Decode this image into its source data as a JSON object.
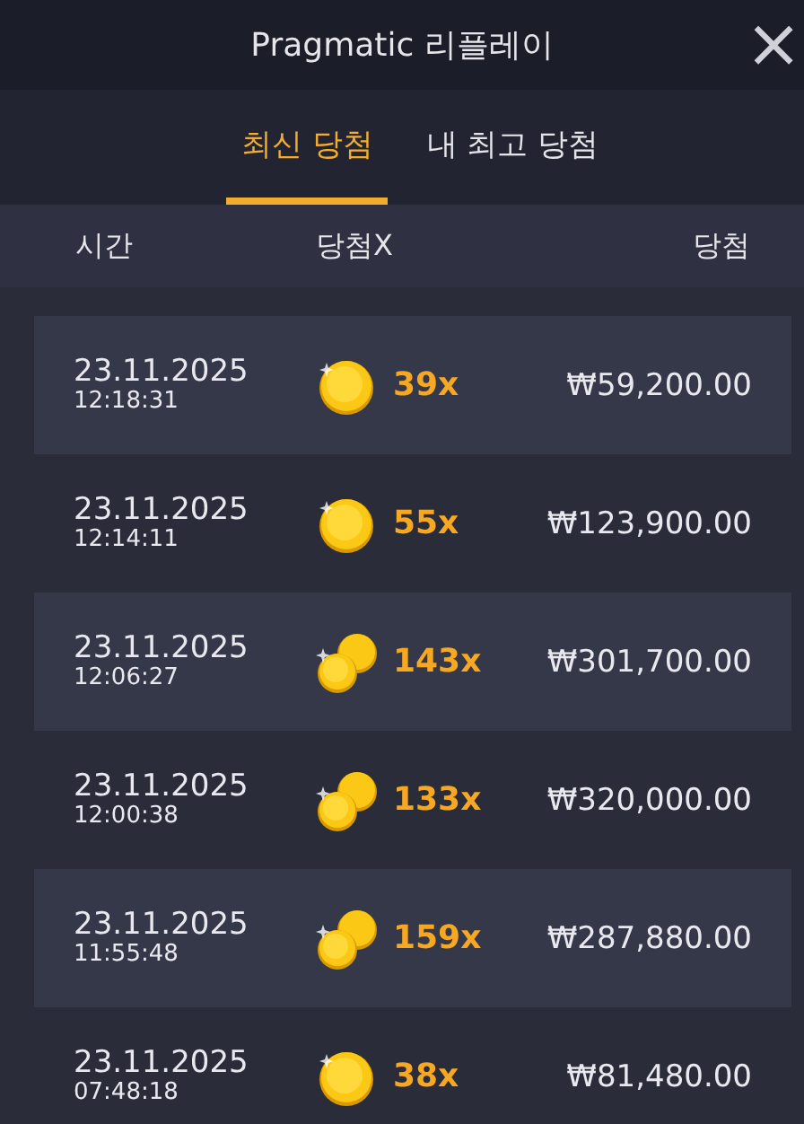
{
  "window": {
    "title": "Pragmatic 리플레이",
    "close": "×"
  },
  "tabs": [
    {
      "label": "최신 당첨",
      "selected": true
    },
    {
      "label": "내 최고 당첨",
      "selected": false
    }
  ],
  "columns": [
    "시간",
    "당첨X",
    "당첨"
  ],
  "rows": [
    {
      "date": "23.11.2025",
      "time": "12:18:31",
      "kind": "single",
      "multiplier": "39x",
      "win": "₩59,200.00"
    },
    {
      "date": "23.11.2025",
      "time": "12:14:11",
      "kind": "single",
      "multiplier": "55x",
      "win": "₩123,900.00"
    },
    {
      "date": "23.11.2025",
      "time": "12:06:27",
      "kind": "stack",
      "multiplier": "143x",
      "win": "₩301,700.00"
    },
    {
      "date": "23.11.2025",
      "time": "12:00:38",
      "kind": "stack",
      "multiplier": "133x",
      "win": "₩320,000.00"
    },
    {
      "date": "23.11.2025",
      "time": "11:55:48",
      "kind": "stack",
      "multiplier": "159x",
      "win": "₩287,880.00"
    },
    {
      "date": "23.11.2025",
      "time": "07:48:18",
      "kind": "single",
      "multiplier": "38x",
      "win": "₩81,480.00"
    }
  ]
}
